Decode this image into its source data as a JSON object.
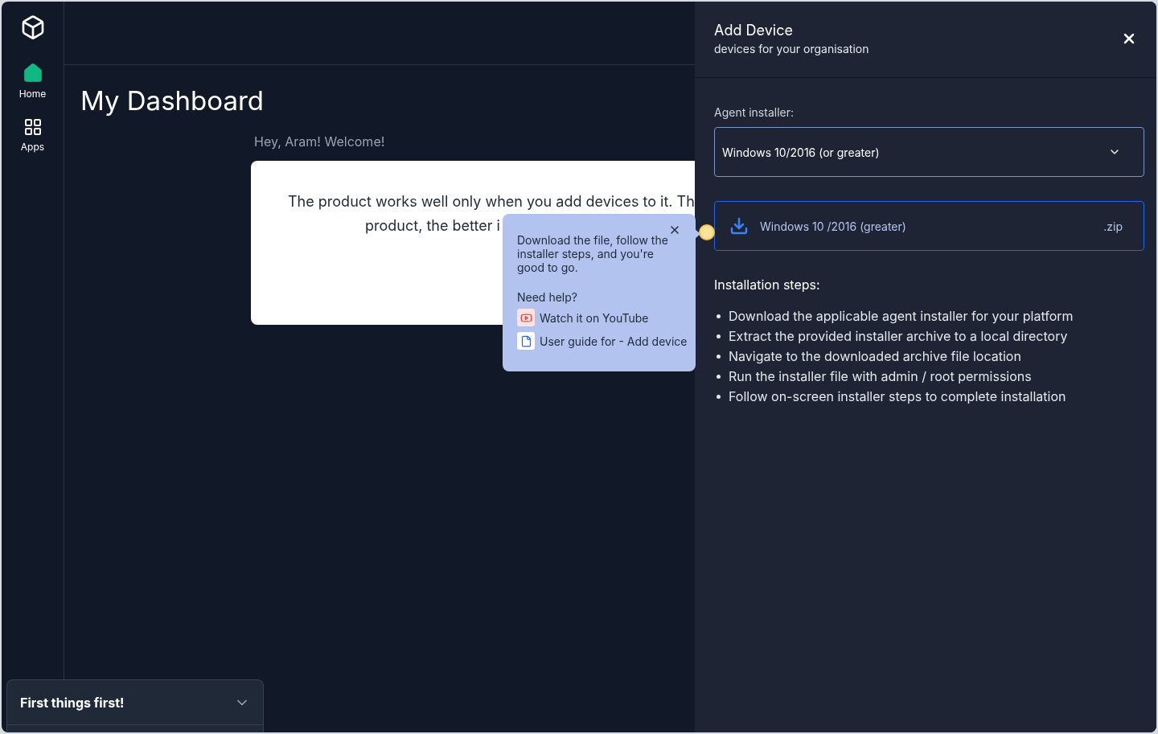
{
  "sidebar": {
    "items": [
      {
        "label": "Home",
        "kind": "home",
        "selected": true
      },
      {
        "label": "Apps",
        "kind": "apps",
        "selected": false
      }
    ]
  },
  "main": {
    "title": "My Dashboard",
    "greeting": "Hey, Aram! Welcome!",
    "card_lines": [
      "The product works well only when you add devices to it. Th",
      "product, the better i"
    ]
  },
  "popover": {
    "text": "Download the file, follow the installer steps, and you're good to go.",
    "help_title": "Need help?",
    "links": [
      {
        "kind": "video",
        "label": "Watch it on YouTube"
      },
      {
        "kind": "doc",
        "label": "User guide for - Add device"
      }
    ]
  },
  "checklist": {
    "title": "First things first!",
    "expanded": false
  },
  "panel": {
    "title": "Add Device",
    "subtitle": "devices for your organisation",
    "installer_label": "Agent installer:",
    "installer_value": "Windows 10/2016 (or greater)",
    "download": {
      "name": "Windows 10 /2016 (greater)",
      "ext": ".zip"
    },
    "steps_title": "Installation steps:",
    "steps": [
      "Download the applicable agent installer for your platform",
      "Extract the provided installer archive to a local directory",
      "Navigate to the downloaded archive file location",
      "Run the installer file with admin / root permissions",
      "Follow on-screen installer steps to complete installation"
    ]
  }
}
